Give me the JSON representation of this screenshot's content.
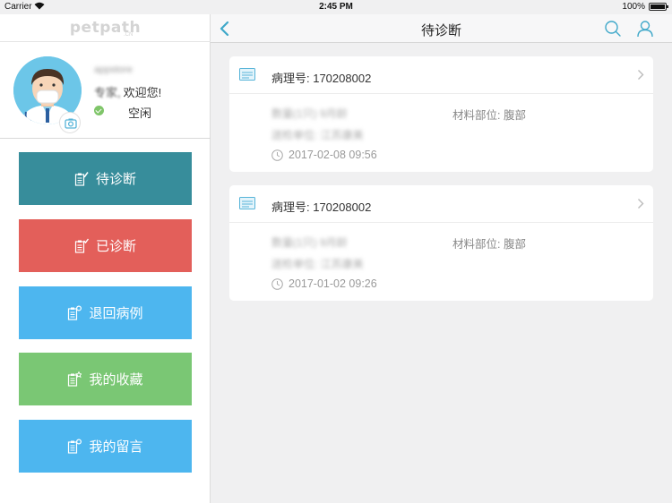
{
  "status_bar": {
    "carrier": "Carrier",
    "time": "2:45 PM",
    "battery": "100%"
  },
  "sidebar": {
    "logo": {
      "text": "petpath",
      "sub": ".CN"
    },
    "profile": {
      "username": "appstore",
      "role": "专家,",
      "welcome": "欢迎您!",
      "status": "空闲"
    },
    "menu": [
      {
        "label": "待诊断",
        "color": "#378d9b"
      },
      {
        "label": "已诊断",
        "color": "#e35f5a"
      },
      {
        "label": "退回病例",
        "color": "#4db6ef"
      },
      {
        "label": "我的收藏",
        "color": "#7ac774"
      },
      {
        "label": "我的留言",
        "color": "#4db6ef"
      }
    ]
  },
  "navbar": {
    "title": "待诊断"
  },
  "cases": [
    {
      "case_no": "病理号: 170208002",
      "blurred_line1": "数量(1只) 9月龄",
      "blurred_line2": "送检单位: 江苏康美",
      "material": "材料部位: 腹部",
      "datetime": "2017-02-08 09:56"
    },
    {
      "case_no": "病理号: 170208002",
      "blurred_line1": "数量(1只) 9月龄",
      "blurred_line2": "送检单位: 江苏康美",
      "material": "材料部位: 腹部",
      "datetime": "2017-01-02 09:26"
    }
  ]
}
